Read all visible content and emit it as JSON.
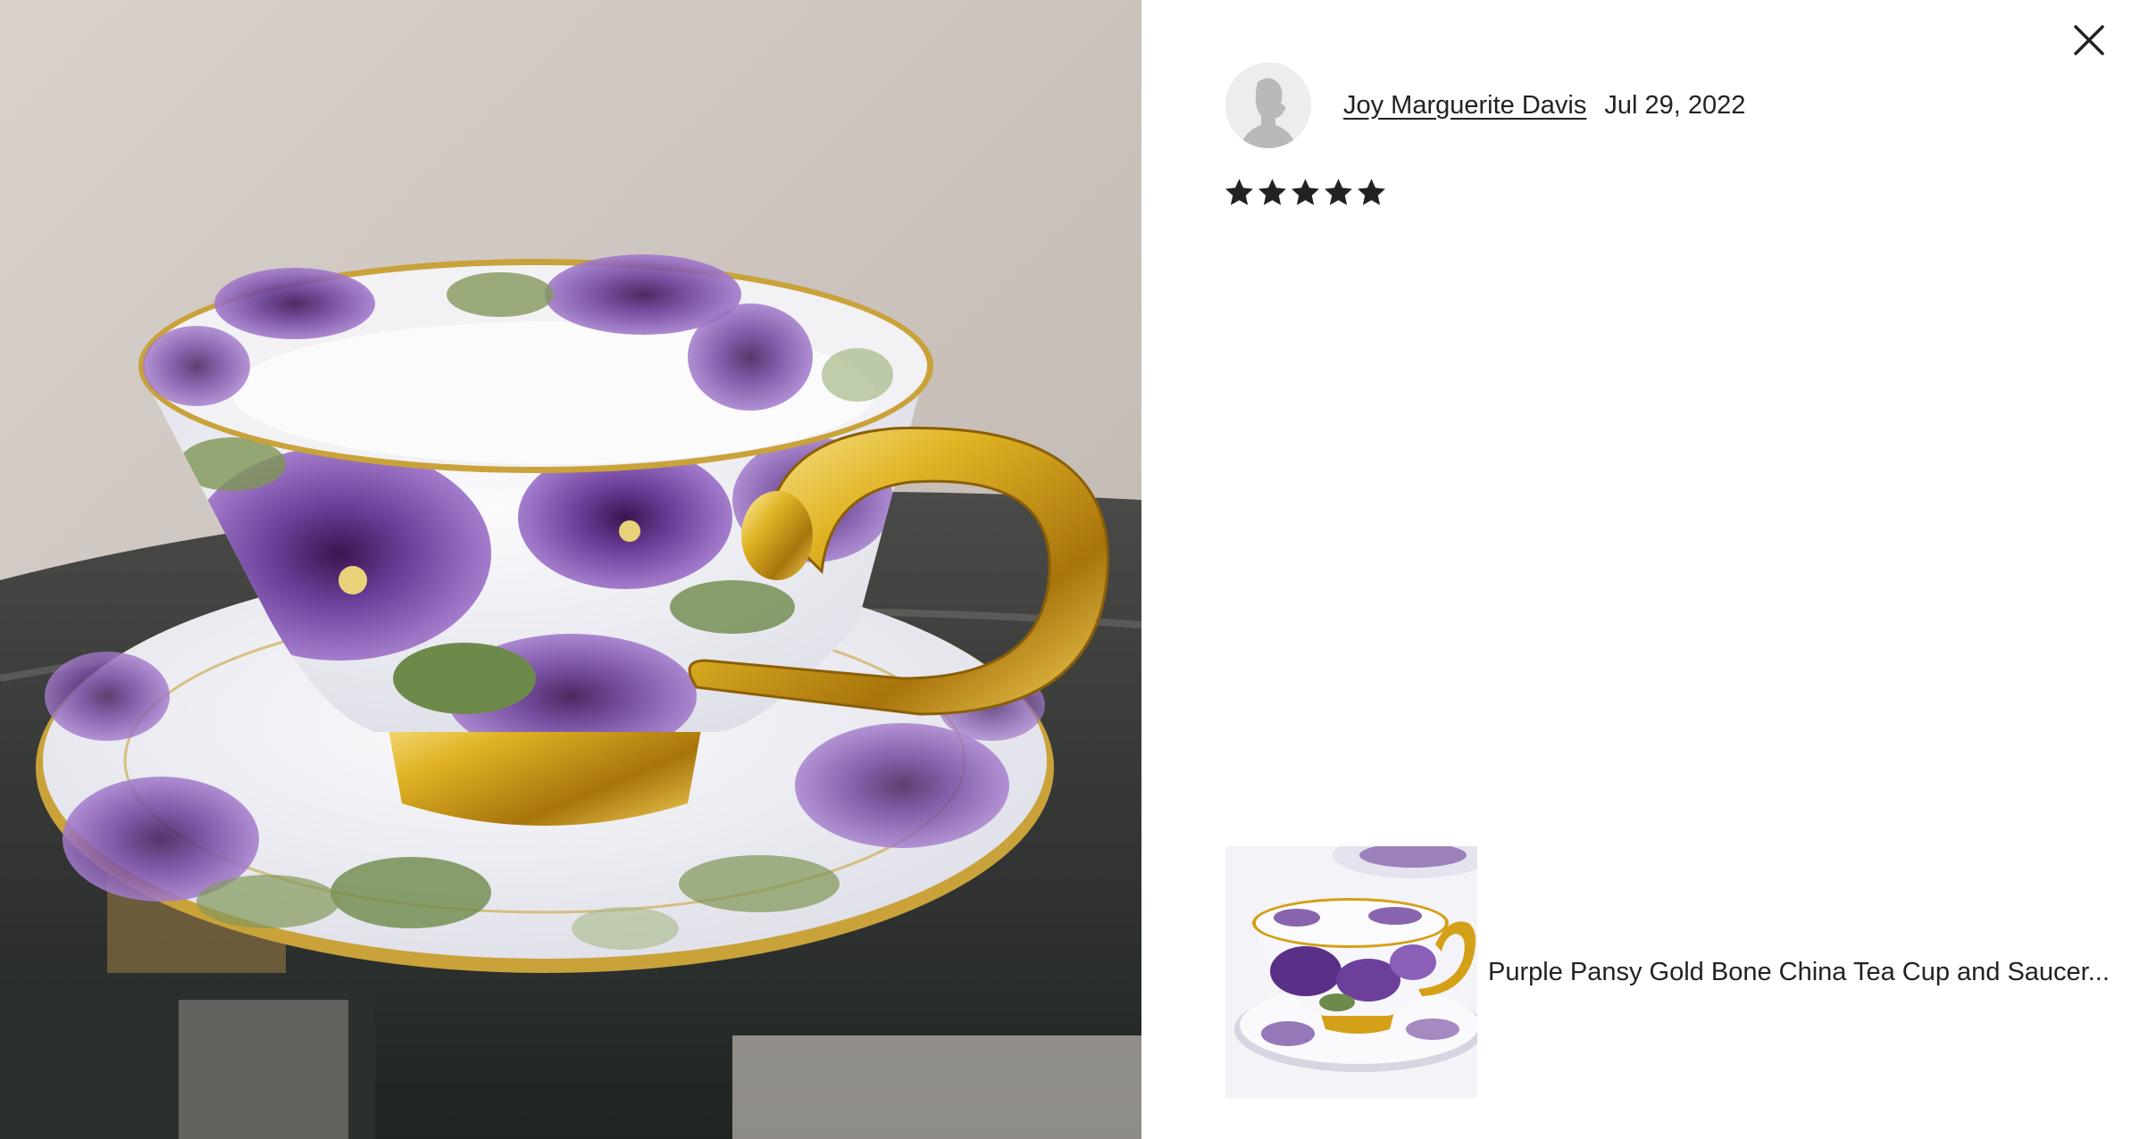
{
  "photo": {
    "alt": "Purple pansy bone china tea cup with gold handle on matching saucer"
  },
  "close_button": {
    "icon": "close-icon",
    "label": "Close"
  },
  "review": {
    "reviewer_name": "Joy Marguerite Davis",
    "date": "Jul 29, 2022",
    "rating": 5,
    "rating_max": 5,
    "star_color": "#222222"
  },
  "listing": {
    "title": "Purple Pansy Gold Bone China Tea Cup and Saucer..."
  },
  "colors": {
    "text": "#222222",
    "avatar_bg": "#ededeb",
    "pansy_purple": "#6b3f9a",
    "gold": "#d4a017"
  }
}
